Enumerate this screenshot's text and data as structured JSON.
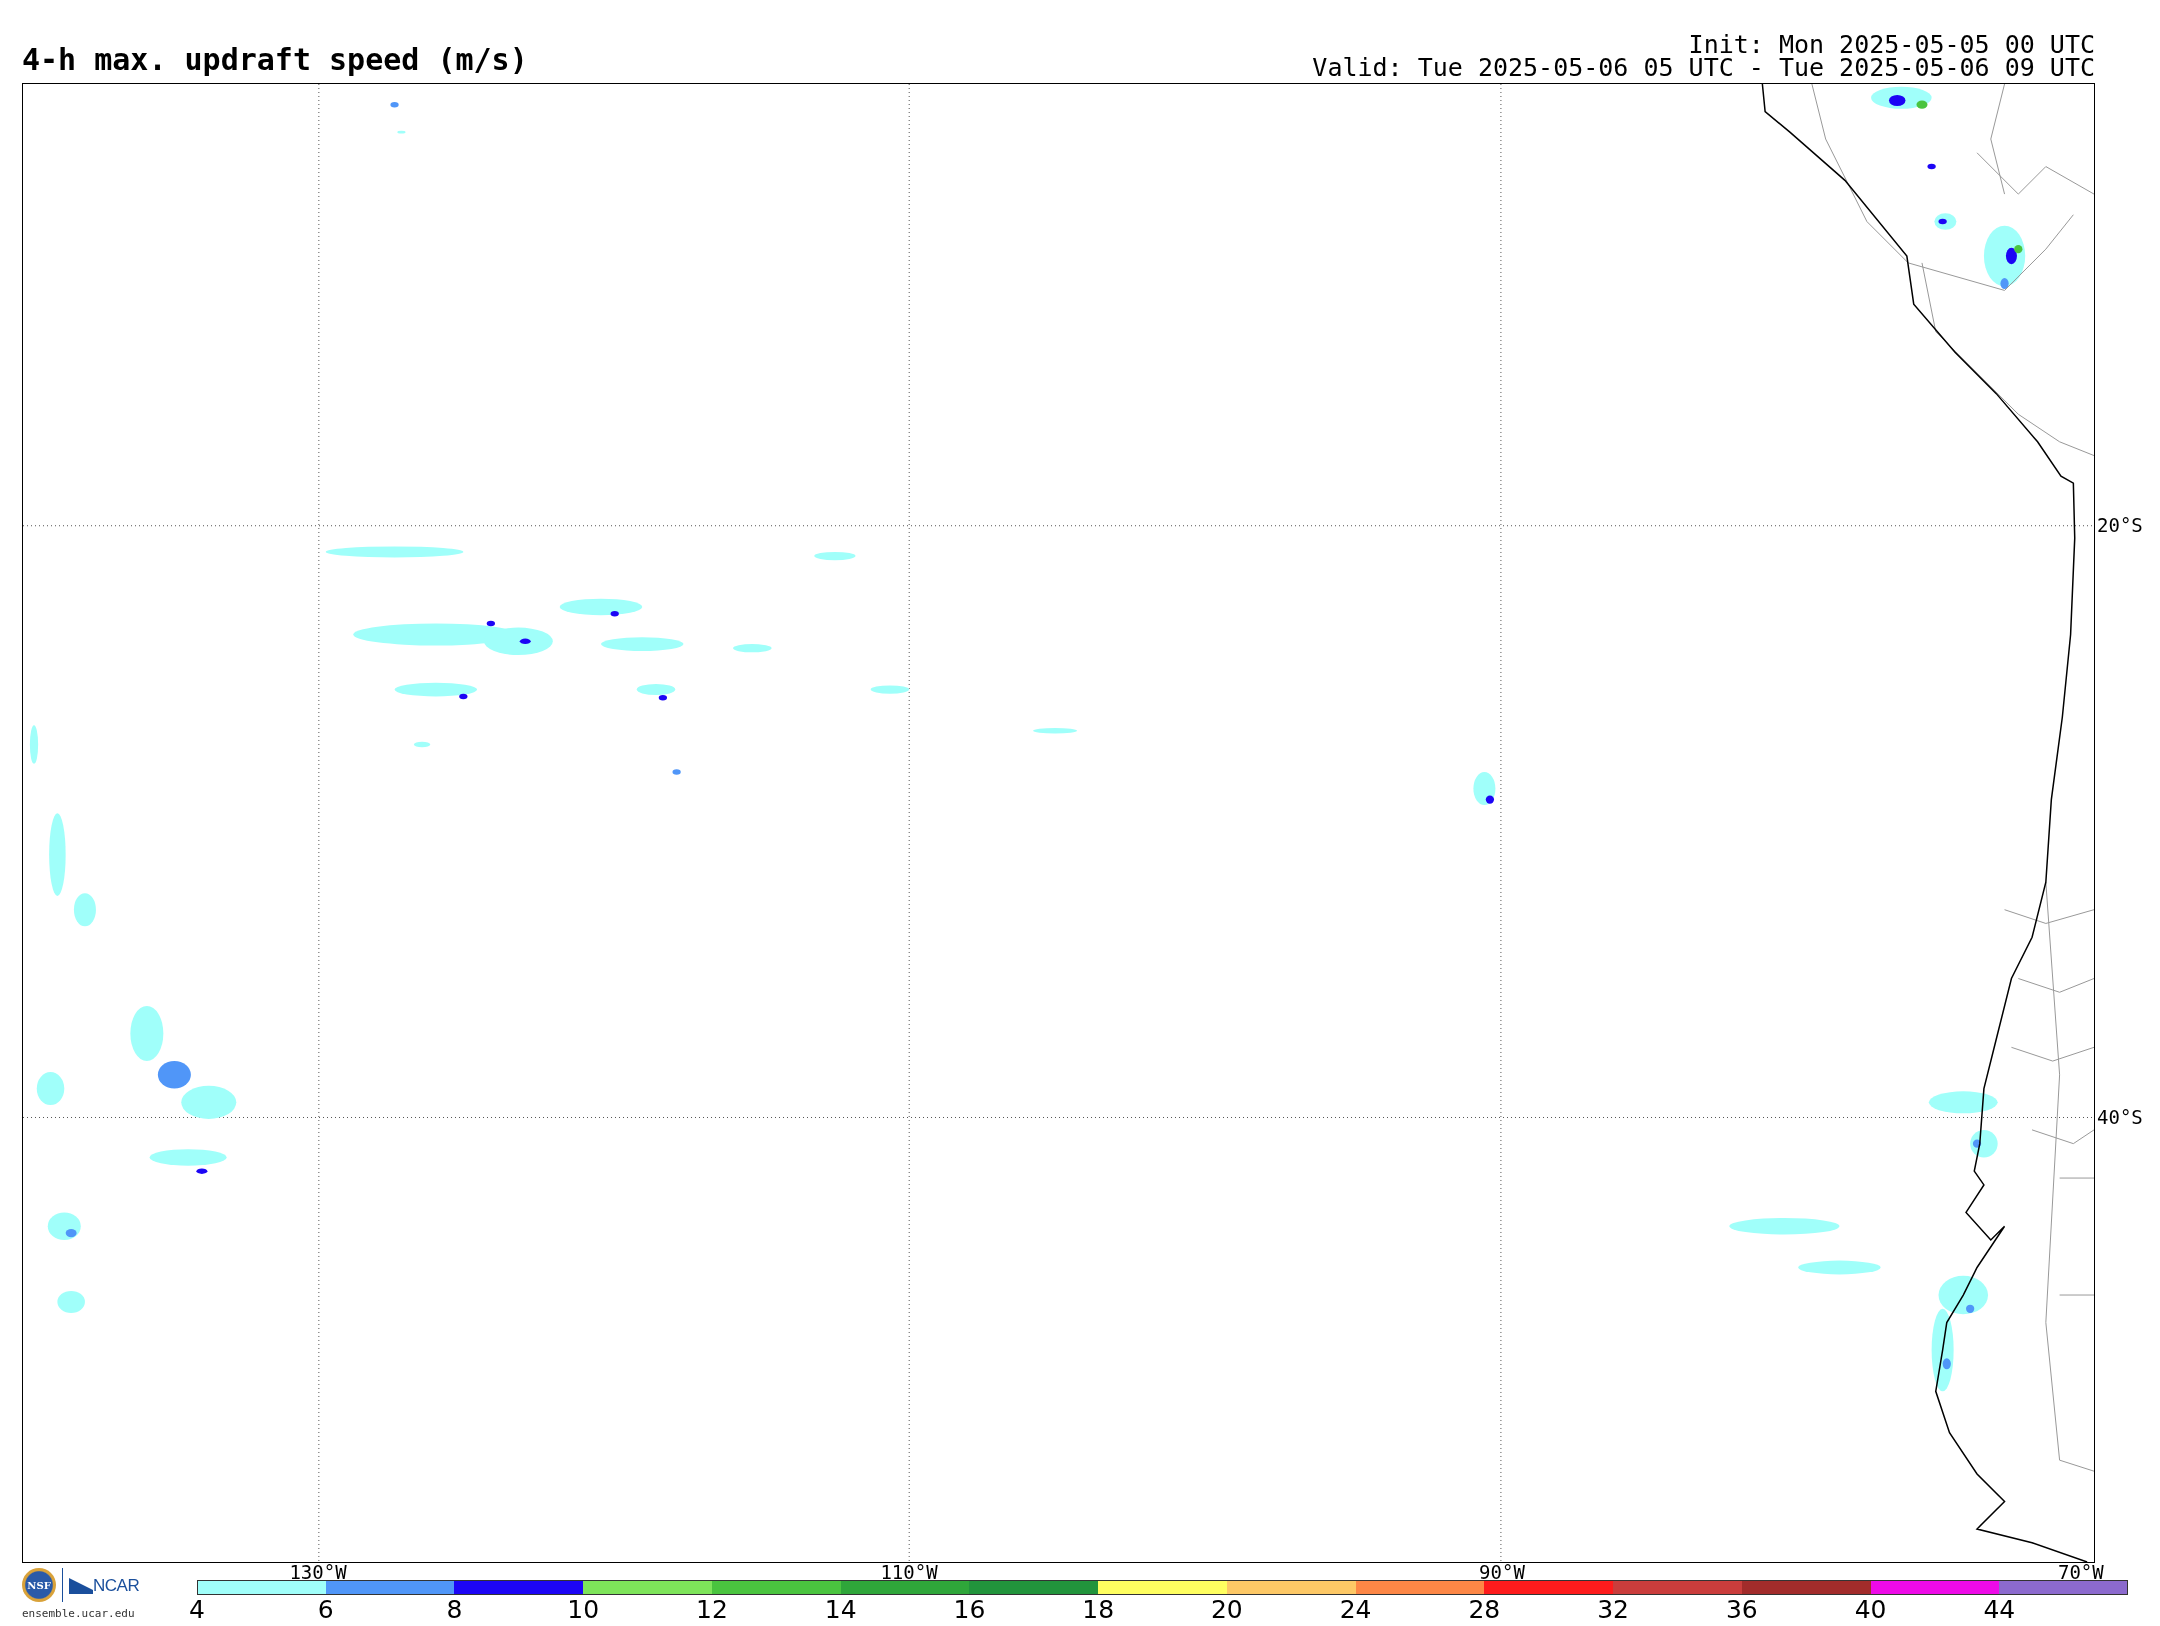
{
  "title": "4-h max. updraft speed (m/s)",
  "init": "Init: Mon 2025-05-05 00 UTC",
  "valid": "Valid: Tue 2025-05-06 05 UTC - Tue 2025-05-06 09 UTC",
  "map": {
    "latitude_labels": [
      "20°S",
      "40°S"
    ],
    "longitude_labels": [
      "130°W",
      "110°W",
      "90°W",
      "70°W"
    ]
  },
  "logo": {
    "nsf": "NSF",
    "ncar": "NCAR",
    "url": "ensemble.ucar.edu"
  },
  "colorbar": {
    "bins": [
      {
        "label": "4",
        "color": "#a0fffa"
      },
      {
        "label": "6",
        "color": "#5096f8"
      },
      {
        "label": "8",
        "color": "#1c05f5"
      },
      {
        "label": "10",
        "color": "#7ee45a"
      },
      {
        "label": "12",
        "color": "#4ac43f"
      },
      {
        "label": "14",
        "color": "#2fa63a"
      },
      {
        "label": "16",
        "color": "#22943c"
      },
      {
        "label": "18",
        "color": "#ffff60"
      },
      {
        "label": "20",
        "color": "#fdc866"
      },
      {
        "label": "24",
        "color": "#fd8746"
      },
      {
        "label": "28",
        "color": "#fe1b1c"
      },
      {
        "label": "32",
        "color": "#ca3d3c"
      },
      {
        "label": "36",
        "color": "#a22c2b"
      },
      {
        "label": "40",
        "color": "#ee0ae8"
      },
      {
        "label": "44",
        "color": "#8c6ace"
      }
    ]
  }
}
